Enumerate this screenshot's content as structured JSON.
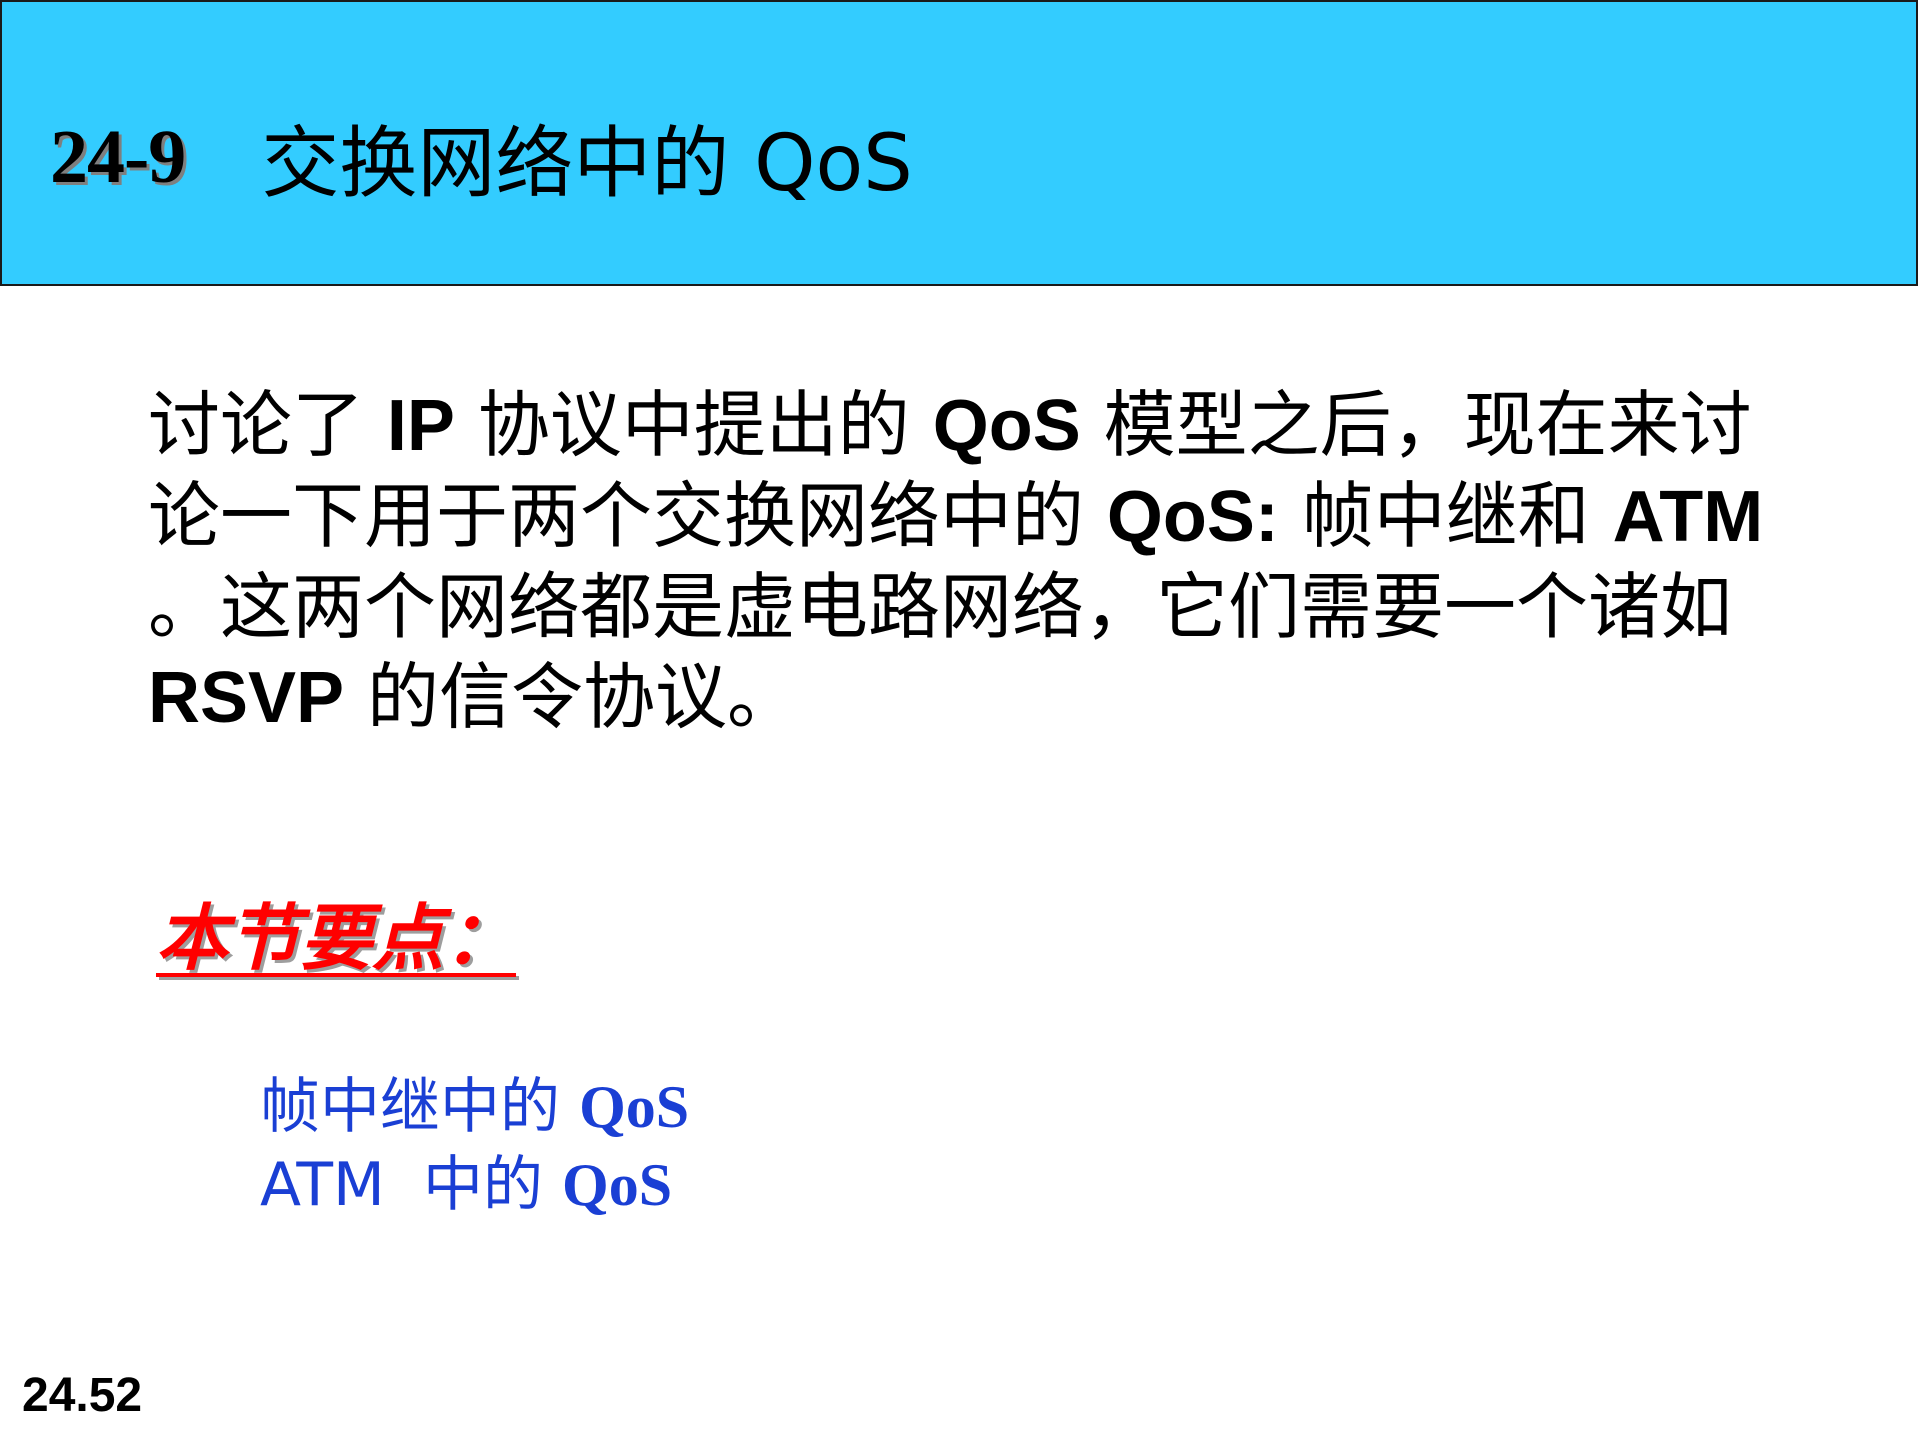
{
  "header": {
    "section_number": "24-9",
    "section_title": "交换网络中的 QoS",
    "background_color": "#33ccff"
  },
  "intro": {
    "segments": [
      "讨论了 ",
      "IP",
      " 协议中提出的 ",
      "QoS",
      " 模型之后，现在来讨论一下用于两个交换网络中的 ",
      "QoS:",
      " 帧中继和 ",
      "ATM",
      " 。这两个网络都是虚电路网络，它们需要一个诸如 ",
      "RSVP",
      " 的信令协议。"
    ]
  },
  "key_points": {
    "label": "本节要点：",
    "label_color": "#ff0000",
    "items": [
      {
        "prefix": "帧中继中的 ",
        "term": "QoS"
      },
      {
        "prefix": "ATM  中的 ",
        "term": "QoS"
      }
    ],
    "item_color": "#1a3fd4"
  },
  "footer": {
    "slide_number": "24.52"
  }
}
